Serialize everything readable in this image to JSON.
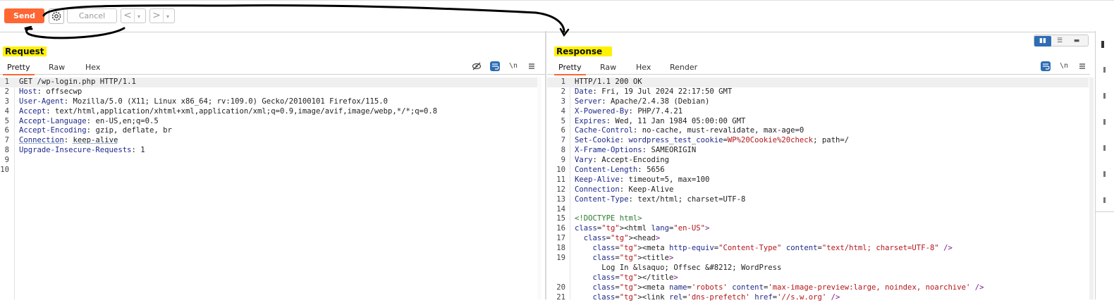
{
  "toolbar": {
    "send_label": "Send",
    "gear_icon": "gear-icon",
    "cancel_label": "Cancel",
    "back_label": "<",
    "forward_label": ">",
    "dropdown_label": "▾"
  },
  "request": {
    "title": "Request",
    "tabs": [
      "Pretty",
      "Raw",
      "Hex"
    ],
    "active_tab": "Pretty",
    "lines": [
      {
        "n": "1",
        "k": "",
        "v": "GET /wp-login.php HTTP/1.1"
      },
      {
        "n": "2",
        "k": "Host",
        "v": "offsecwp"
      },
      {
        "n": "3",
        "k": "User-Agent",
        "v": "Mozilla/5.0 (X11; Linux x86_64; rv:109.0) Gecko/20100101 Firefox/115.0"
      },
      {
        "n": "4",
        "k": "Accept",
        "v": "text/html,application/xhtml+xml,application/xml;q=0.9,image/avif,image/webp,*/*;q=0.8"
      },
      {
        "n": "5",
        "k": "Accept-Language",
        "v": "en-US,en;q=0.5"
      },
      {
        "n": "6",
        "k": "Accept-Encoding",
        "v": "gzip, deflate, br"
      },
      {
        "n": "7",
        "k": "Connection",
        "v": "keep-alive"
      },
      {
        "n": "8",
        "k": "Upgrade-Insecure-Requests",
        "v": "1"
      },
      {
        "n": "9",
        "k": "",
        "v": ""
      },
      {
        "n": "10",
        "k": "",
        "v": ""
      }
    ]
  },
  "response": {
    "title": "Response",
    "tabs": [
      "Pretty",
      "Raw",
      "Hex",
      "Render"
    ],
    "active_tab": "Pretty",
    "lines": [
      {
        "n": "1",
        "k": "",
        "v": "HTTP/1.1 200 OK"
      },
      {
        "n": "2",
        "k": "Date",
        "v": "Fri, 19 Jul 2024 22:17:50 GMT"
      },
      {
        "n": "3",
        "k": "Server",
        "v": "Apache/2.4.38 (Debian)"
      },
      {
        "n": "4",
        "k": "X-Powered-By",
        "v": "PHP/7.4.21"
      },
      {
        "n": "5",
        "k": "Expires",
        "v": "Wed, 11 Jan 1984 05:00:00 GMT"
      },
      {
        "n": "6",
        "k": "Cache-Control",
        "v": "no-cache, must-revalidate, max-age=0"
      },
      {
        "n": "7",
        "k": "Set-Cookie",
        "v": "wordpress_test_cookie=WP%20Cookie%20check; path=/"
      },
      {
        "n": "8",
        "k": "X-Frame-Options",
        "v": "SAMEORIGIN"
      },
      {
        "n": "9",
        "k": "Vary",
        "v": "Accept-Encoding"
      },
      {
        "n": "10",
        "k": "Content-Length",
        "v": "5656"
      },
      {
        "n": "11",
        "k": "Keep-Alive",
        "v": "timeout=5, max=100"
      },
      {
        "n": "12",
        "k": "Connection",
        "v": "Keep-Alive"
      },
      {
        "n": "13",
        "k": "Content-Type",
        "v": "text/html; charset=UTF-8"
      },
      {
        "n": "14",
        "k": "",
        "v": ""
      },
      {
        "n": "15",
        "k": "",
        "v": "<!DOCTYPE html>"
      },
      {
        "n": "16",
        "k": "",
        "v": "<html lang=\"en-US\">"
      },
      {
        "n": "17",
        "k": "",
        "v": "  <head>"
      },
      {
        "n": "18",
        "k": "",
        "v": "    <meta http-equiv=\"Content-Type\" content=\"text/html; charset=UTF-8\" />"
      },
      {
        "n": "19",
        "k": "",
        "v": "    <title>"
      },
      {
        "n": "",
        "k": "",
        "v": "      Log In &lsaquo; Offsec &#8212; WordPress"
      },
      {
        "n": "",
        "k": "",
        "v": "    </title>"
      },
      {
        "n": "20",
        "k": "",
        "v": "    <meta name='robots' content='max-image-preview:large, noindex, noarchive' />"
      },
      {
        "n": "21",
        "k": "",
        "v": "    <link rel='dns-prefetch' href='//s.w.org' />"
      }
    ]
  },
  "icons": {
    "hide": "eye-off-icon",
    "wrap": "wrap-icon",
    "newline": "\\n",
    "menu": "menu-icon"
  },
  "layout_options": [
    "split-horizontal-icon",
    "split-vertical-icon",
    "tabs-icon"
  ],
  "colors": {
    "send": "#ff6633",
    "highlight": "#fff200",
    "accent": "#2e6db4",
    "annotation": "#000000"
  }
}
